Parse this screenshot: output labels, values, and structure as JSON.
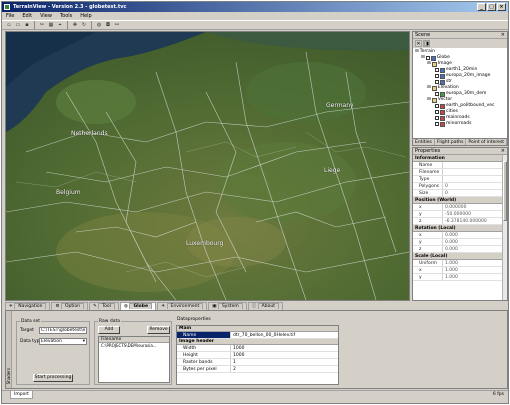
{
  "window": {
    "title": "TerrainView - Version 2.3 - globetest.tvc",
    "controls": [
      "_",
      "□",
      "×"
    ]
  },
  "menu": [
    "File",
    "Edit",
    "View",
    "Tools",
    "Help"
  ],
  "map": {
    "labels": [
      "Netherlands",
      "Germany",
      "Belgium",
      "Luxembourg",
      "Liege"
    ]
  },
  "scene": {
    "title": "Scene",
    "close": "×",
    "tree": [
      {
        "label": "Terrain"
      },
      {
        "label": "Globe"
      },
      {
        "label": "Image"
      },
      {
        "label": "earth1_20min"
      },
      {
        "label": "europa_20m_image"
      },
      {
        "label": "str"
      },
      {
        "label": "Elevation"
      },
      {
        "label": "europa_30m_dem"
      },
      {
        "label": "Vector"
      },
      {
        "label": "earth_politbound_vec"
      },
      {
        "label": "cities"
      },
      {
        "label": "mainroads"
      },
      {
        "label": "minorroads"
      }
    ],
    "tabs": [
      "Entities",
      "Flight paths",
      "Point of interest"
    ]
  },
  "properties": {
    "title": "Properties",
    "close": "×",
    "groups": [
      {
        "name": "Information",
        "rows": [
          {
            "k": "Name",
            "v": ""
          },
          {
            "k": "Filename",
            "v": ""
          },
          {
            "k": "Type",
            "v": ""
          },
          {
            "k": "Polygons",
            "v": "0"
          },
          {
            "k": "Size",
            "v": "0"
          }
        ]
      },
      {
        "name": "Position (World)",
        "rows": [
          {
            "k": "x",
            "v": "0.000000"
          },
          {
            "k": "y",
            "v": "-50.000000"
          },
          {
            "k": "z",
            "v": "-6.378140.000000"
          }
        ]
      },
      {
        "name": "Rotation (Local)",
        "rows": [
          {
            "k": "x",
            "v": "0.000"
          },
          {
            "k": "y",
            "v": "0.000"
          },
          {
            "k": "z",
            "v": "0.000"
          }
        ]
      },
      {
        "name": "Scale (Local)",
        "rows": [
          {
            "k": "Uniform",
            "v": "1.000"
          },
          {
            "k": "x",
            "v": "1.000"
          },
          {
            "k": "y",
            "v": "1.000"
          }
        ]
      }
    ]
  },
  "bottom_tabs": [
    "Navigation",
    "Option",
    "Tool",
    "Globe",
    "Environment",
    "System",
    "About"
  ],
  "data_set": {
    "legend": "Data set",
    "target_label": "Target",
    "target_value": "C:\\TEST\\globetest\\e",
    "type_label": "Data type",
    "type_value": "Elevation",
    "start_button": "Start processing"
  },
  "raw_data": {
    "legend": "Raw data",
    "add_button": "Add",
    "remove_button": "Remove",
    "list_header": "Filename",
    "files": [
      "C:\\PROJECTS\\DEM\\eurasia..."
    ]
  },
  "data_properties": {
    "legend": "Dataproperties",
    "groups": [
      {
        "name": "Main",
        "rows": [
          {
            "k": "Name",
            "v": "dtr_70_bellon_00_0Helev.tif",
            "selected": true
          }
        ]
      },
      {
        "name": "Image header",
        "rows": [
          {
            "k": "Width",
            "v": "1000"
          },
          {
            "k": "Height",
            "v": "1000"
          },
          {
            "k": "Raster bands",
            "v": "1"
          },
          {
            "k": "Bytes per pixel",
            "v": "2"
          }
        ]
      }
    ]
  },
  "side_strip": "Shaders",
  "status": {
    "tab": "Import",
    "fps": "6 fps"
  }
}
